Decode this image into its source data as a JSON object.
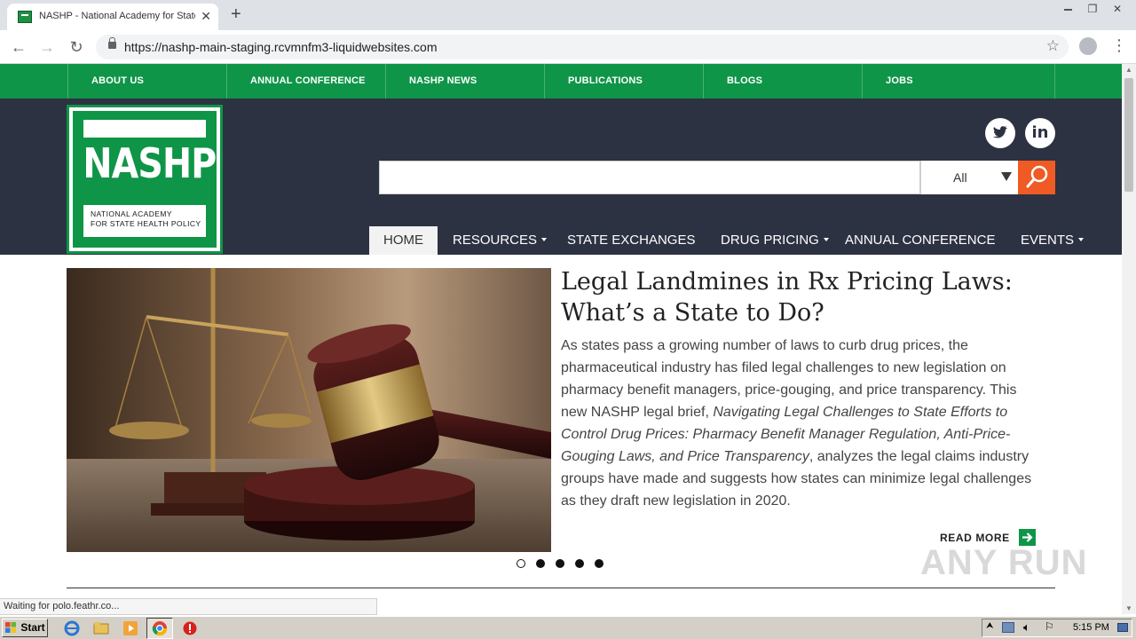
{
  "browser": {
    "tab_title": "NASHP - National Academy for State Health Policy",
    "tab_close": "✕",
    "new_tab": "+",
    "url": "https://nashp-main-staging.rcvmnfm3-liquidwebsites.com",
    "back": "←",
    "forward": "→",
    "reload": "↻",
    "bookmark_star": "☆",
    "menu": "⋮",
    "win_restore": "❐",
    "win_close": "✕"
  },
  "topnav": {
    "items": [
      "ABOUT US",
      "ANNUAL CONFERENCE",
      "NASHP NEWS",
      "PUBLICATIONS",
      "BLOGS",
      "JOBS"
    ]
  },
  "logo": {
    "word": "NASHP",
    "line1": "NATIONAL ACADEMY",
    "line2": "FOR STATE HEALTH POLICY"
  },
  "social": {
    "linkedin": "in"
  },
  "search": {
    "value": "",
    "select_value": "All"
  },
  "mainnav": {
    "home": "HOME",
    "resources": "RESOURCES",
    "state_exchanges": "STATE EXCHANGES",
    "drug_pricing": "DRUG PRICING",
    "annual_conference": "ANNUAL CONFERENCE",
    "events": "EVENTS"
  },
  "hero": {
    "title": "Legal Landmines in Rx Pricing Laws: What’s a State to Do?",
    "body_part1": "As states pass a growing number of laws to curb drug prices, the pharmaceutical industry has filed legal challenges to new legislation on pharmacy benefit managers, price-gouging, and price transparency. This new NASHP legal brief, ",
    "body_italic": "Navigating Legal Challenges to State Efforts to Control Drug Prices: Pharmacy Benefit Manager Regulation, Anti-Price-Gouging Laws, and Price Transparency",
    "body_part2": ", analyzes the legal claims industry groups have made and suggests how states can minimize legal challenges as they draft new legislation in 2020.",
    "read_more": "READ MORE",
    "slide_count": 5,
    "active_slide": 1
  },
  "status": {
    "text": "Waiting for polo.feathr.co..."
  },
  "watermark": "ANY RUN",
  "taskbar": {
    "start": "Start",
    "time": "5:15 PM"
  },
  "colors": {
    "green": "#0f9547",
    "header_bg": "#2d3242",
    "search_orange": "#f05a24"
  }
}
